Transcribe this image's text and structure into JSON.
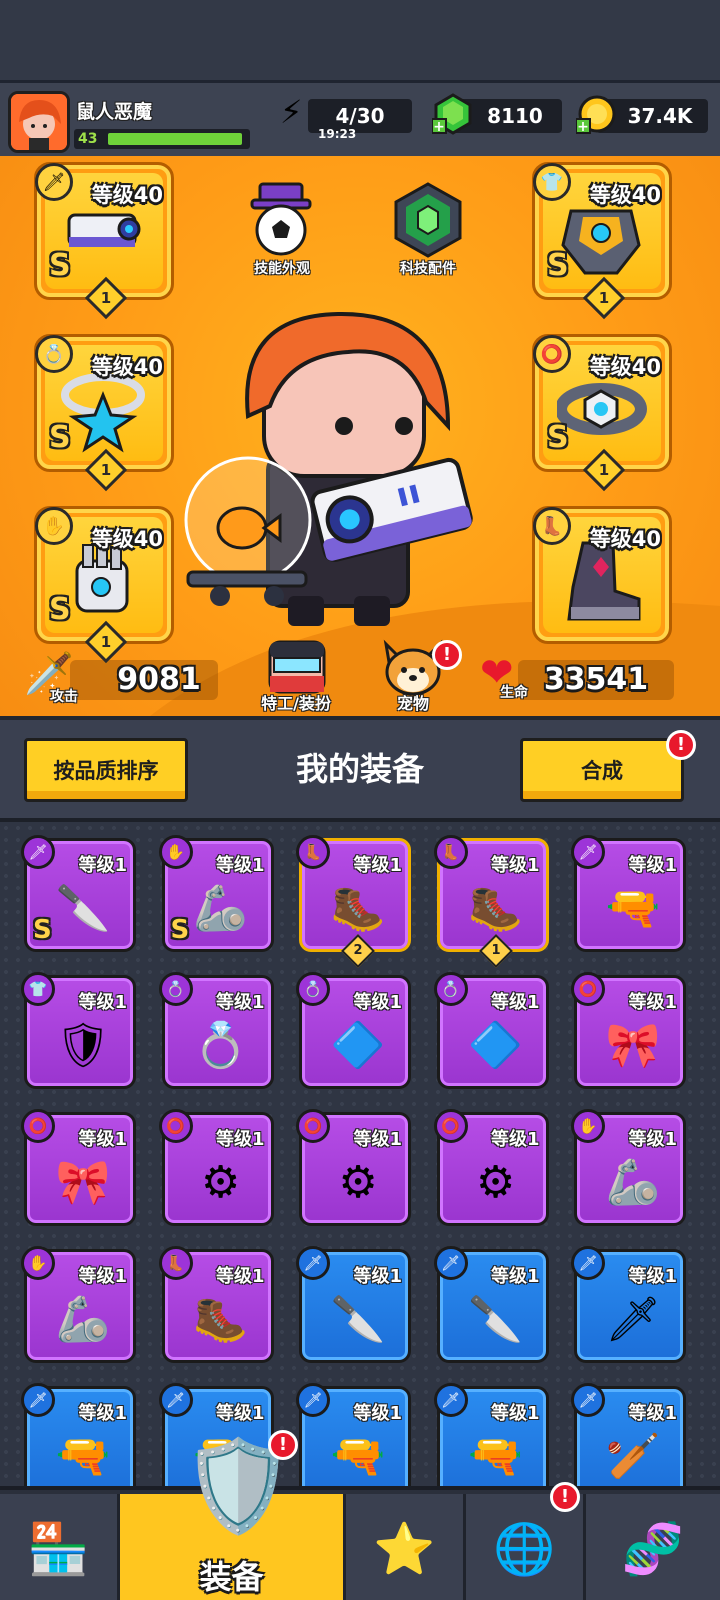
{
  "player": {
    "name": "鼠人恶魔",
    "level": "43",
    "xp_fraction": 0.85
  },
  "resources": {
    "energy": {
      "value": "4/30",
      "timer": "19:23"
    },
    "gems": {
      "value": "8110"
    },
    "coins": {
      "value": "37.4K"
    }
  },
  "hero": {
    "slots_left": [
      {
        "level": "等级40",
        "grade": "S",
        "count": "1",
        "type_icon": "weapon-icon",
        "art": "blaster-gun"
      },
      {
        "level": "等级40",
        "grade": "S",
        "count": "1",
        "type_icon": "necklace-icon",
        "art": "star-necklace"
      },
      {
        "level": "等级40",
        "grade": "S",
        "count": "1",
        "type_icon": "glove-icon",
        "art": "mech-glove"
      }
    ],
    "slots_right": [
      {
        "level": "等级40",
        "grade": "S",
        "count": "1",
        "type_icon": "armor-icon",
        "art": "mech-armor"
      },
      {
        "level": "等级40",
        "grade": "S",
        "count": "1",
        "type_icon": "ring-icon",
        "art": "hex-belt"
      },
      {
        "level": "等级40",
        "grade": "",
        "count": "",
        "type_icon": "boots-icon",
        "art": "mech-boots"
      }
    ],
    "skill_skin_label": "技能外观",
    "tech_parts_label": "科技配件",
    "agent_label": "特工/装扮",
    "pet_label": "宠物",
    "attack_label": "攻击",
    "attack_value": "9081",
    "hp_label": "生命",
    "hp_value": "33541"
  },
  "section": {
    "sort_label": "按品质排序",
    "title": "我的装备",
    "merge_label": "合成"
  },
  "inventory": [
    {
      "rarity": "purple",
      "level": "等级1",
      "icon": "🗡",
      "art": "🔪",
      "grade": "S",
      "count": ""
    },
    {
      "rarity": "purple",
      "level": "等级1",
      "icon": "✋",
      "art": "🦾",
      "grade": "S",
      "count": ""
    },
    {
      "rarity": "purple",
      "level": "等级1",
      "icon": "👢",
      "art": "🥾",
      "grade": "",
      "count": "2",
      "gold": true
    },
    {
      "rarity": "purple",
      "level": "等级1",
      "icon": "👢",
      "art": "🥾",
      "grade": "",
      "count": "1",
      "gold": true
    },
    {
      "rarity": "purple",
      "level": "等级1",
      "icon": "🗡",
      "art": "🔫",
      "grade": "",
      "count": ""
    },
    {
      "rarity": "purple",
      "level": "等级1",
      "icon": "👕",
      "art": "🛡",
      "grade": "",
      "count": ""
    },
    {
      "rarity": "purple",
      "level": "等级1",
      "icon": "💍",
      "art": "💍",
      "grade": "",
      "count": ""
    },
    {
      "rarity": "purple",
      "level": "等级1",
      "icon": "💍",
      "art": "🔷",
      "grade": "",
      "count": ""
    },
    {
      "rarity": "purple",
      "level": "等级1",
      "icon": "💍",
      "art": "🔷",
      "grade": "",
      "count": ""
    },
    {
      "rarity": "purple",
      "level": "等级1",
      "icon": "⭕",
      "art": "🎀",
      "grade": "",
      "count": ""
    },
    {
      "rarity": "purple",
      "level": "等级1",
      "icon": "⭕",
      "art": "🎀",
      "grade": "",
      "count": ""
    },
    {
      "rarity": "purple",
      "level": "等级1",
      "icon": "⭕",
      "art": "⚙",
      "grade": "",
      "count": ""
    },
    {
      "rarity": "purple",
      "level": "等级1",
      "icon": "⭕",
      "art": "⚙",
      "grade": "",
      "count": ""
    },
    {
      "rarity": "purple",
      "level": "等级1",
      "icon": "⭕",
      "art": "⚙",
      "grade": "",
      "count": ""
    },
    {
      "rarity": "purple",
      "level": "等级1",
      "icon": "✋",
      "art": "🦾",
      "grade": "",
      "count": ""
    },
    {
      "rarity": "purple",
      "level": "等级1",
      "icon": "✋",
      "art": "🦾",
      "grade": "",
      "count": ""
    },
    {
      "rarity": "purple",
      "level": "等级1",
      "icon": "👢",
      "art": "🥾",
      "grade": "",
      "count": ""
    },
    {
      "rarity": "blue",
      "level": "等级1",
      "icon": "🗡",
      "art": "🔪",
      "grade": "",
      "count": ""
    },
    {
      "rarity": "blue",
      "level": "等级1",
      "icon": "🗡",
      "art": "🔪",
      "grade": "",
      "count": ""
    },
    {
      "rarity": "blue",
      "level": "等级1",
      "icon": "🗡",
      "art": "🗡",
      "grade": "",
      "count": ""
    },
    {
      "rarity": "blue",
      "level": "等级1",
      "icon": "🗡",
      "art": "🔫",
      "grade": "",
      "count": ""
    },
    {
      "rarity": "blue",
      "level": "等级1",
      "icon": "🗡",
      "art": "🔫",
      "grade": "",
      "count": ""
    },
    {
      "rarity": "blue",
      "level": "等级1",
      "icon": "🗡",
      "art": "🔫",
      "grade": "",
      "count": ""
    },
    {
      "rarity": "blue",
      "level": "等级1",
      "icon": "🗡",
      "art": "🔫",
      "grade": "",
      "count": ""
    },
    {
      "rarity": "blue",
      "level": "等级1",
      "icon": "🗡",
      "art": "🏏",
      "grade": "",
      "count": ""
    }
  ],
  "nav": {
    "tabs": [
      {
        "name": "shop",
        "icon": "🏪"
      },
      {
        "name": "equipment",
        "icon": "🛡",
        "label": "装备",
        "active": true,
        "badge": "!"
      },
      {
        "name": "talent",
        "icon": "⭐"
      },
      {
        "name": "evolve",
        "icon": "🌐",
        "badge": "!"
      },
      {
        "name": "gene",
        "icon": "🧬"
      }
    ]
  },
  "badges": {
    "pet": "!",
    "merge": "!"
  },
  "colors": {
    "hero_bg": "#ff9c17",
    "purple": "#a53ed9",
    "blue": "#1f76e0",
    "yellow_btn": "#ffcf24"
  }
}
